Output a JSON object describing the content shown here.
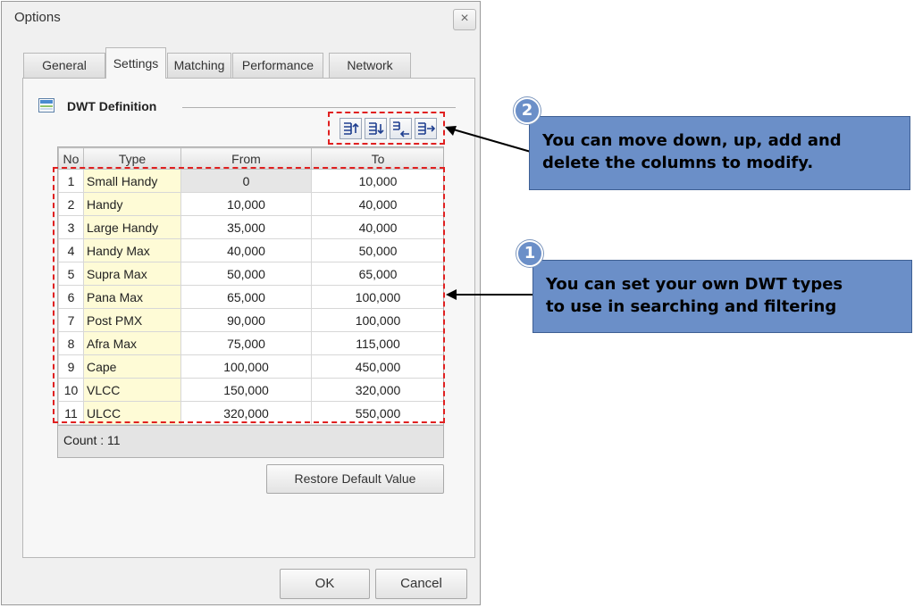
{
  "window": {
    "title": "Options",
    "close": "×"
  },
  "tabs": [
    {
      "label": "General"
    },
    {
      "label": "Settings"
    },
    {
      "label": "Matching"
    },
    {
      "label": "Performance"
    },
    {
      "label": "Network"
    }
  ],
  "section": {
    "title": "DWT Definition"
  },
  "toolbar": {
    "icons": [
      "move-up-icon",
      "move-down-icon",
      "add-column-icon",
      "delete-column-icon"
    ]
  },
  "grid": {
    "headers": {
      "no": "No",
      "type": "Type",
      "from": "From",
      "to": "To"
    },
    "rows": [
      {
        "no": "1",
        "type": "Small Handy",
        "from": "0",
        "to": "10,000"
      },
      {
        "no": "2",
        "type": "Handy",
        "from": "10,000",
        "to": "40,000"
      },
      {
        "no": "3",
        "type": "Large Handy",
        "from": "35,000",
        "to": "40,000"
      },
      {
        "no": "4",
        "type": "Handy Max",
        "from": "40,000",
        "to": "50,000"
      },
      {
        "no": "5",
        "type": "Supra Max",
        "from": "50,000",
        "to": "65,000"
      },
      {
        "no": "6",
        "type": "Pana Max",
        "from": "65,000",
        "to": "100,000"
      },
      {
        "no": "7",
        "type": "Post PMX",
        "from": "90,000",
        "to": "100,000"
      },
      {
        "no": "8",
        "type": "Afra Max",
        "from": "75,000",
        "to": "115,000"
      },
      {
        "no": "9",
        "type": "Cape",
        "from": "100,000",
        "to": "450,000"
      },
      {
        "no": "10",
        "type": "VLCC",
        "from": "150,000",
        "to": "320,000"
      },
      {
        "no": "11",
        "type": "ULCC",
        "from": "320,000",
        "to": "550,000"
      }
    ],
    "count": "Count : 11"
  },
  "buttons": {
    "restore": "Restore Default Value",
    "ok": "OK",
    "cancel": "Cancel"
  },
  "callouts": [
    {
      "badge": "2",
      "text_line1": "You can move down, up, add and",
      "text_line2": "delete the columns to modify."
    },
    {
      "badge": "1",
      "text_line1": "You can set your own DWT types",
      "text_line2": "to use in searching and filtering"
    }
  ],
  "colors": {
    "callout": "#6b8fc8",
    "highlight": "#e02020",
    "type_cell": "#fefbd6"
  }
}
